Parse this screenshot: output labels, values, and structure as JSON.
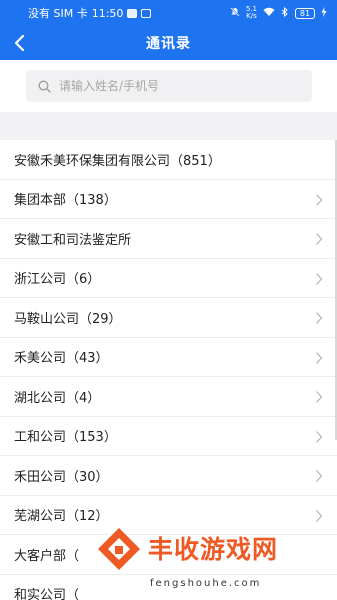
{
  "status_bar": {
    "carrier": "没有 SIM 卡",
    "time": "11:50",
    "net_speed_value": "5.1",
    "net_speed_unit": "K/s",
    "battery": "81"
  },
  "header": {
    "back_icon": "chevron-left-icon",
    "title": "通讯录",
    "bg_color": "#1e74f0"
  },
  "search": {
    "icon": "search-icon",
    "placeholder": "请输入姓名/手机号"
  },
  "contacts": [
    {
      "name": "安徽禾美环保集团有限公司",
      "count": "（851）",
      "has_arrow": false
    },
    {
      "name": "集团本部",
      "count": "（138）",
      "has_arrow": true
    },
    {
      "name": "安徽工和司法鉴定所",
      "count": "",
      "has_arrow": true
    },
    {
      "name": "浙江公司",
      "count": "（6）",
      "has_arrow": true
    },
    {
      "name": "马鞍山公司",
      "count": "（29）",
      "has_arrow": true
    },
    {
      "name": "禾美公司",
      "count": "（43）",
      "has_arrow": true
    },
    {
      "name": "湖北公司",
      "count": "（4）",
      "has_arrow": true
    },
    {
      "name": "工和公司",
      "count": "（153）",
      "has_arrow": true
    },
    {
      "name": "禾田公司",
      "count": "（30）",
      "has_arrow": true
    },
    {
      "name": "芜湖公司",
      "count": "（12）",
      "has_arrow": true
    },
    {
      "name": "大客户部",
      "count": "（",
      "has_arrow": false
    },
    {
      "name": "和实公司",
      "count": "（",
      "has_arrow": false
    }
  ],
  "watermark": {
    "title": "丰收游戏网",
    "subtitle": "fengshouhe.com",
    "color": "#ef5a24"
  }
}
